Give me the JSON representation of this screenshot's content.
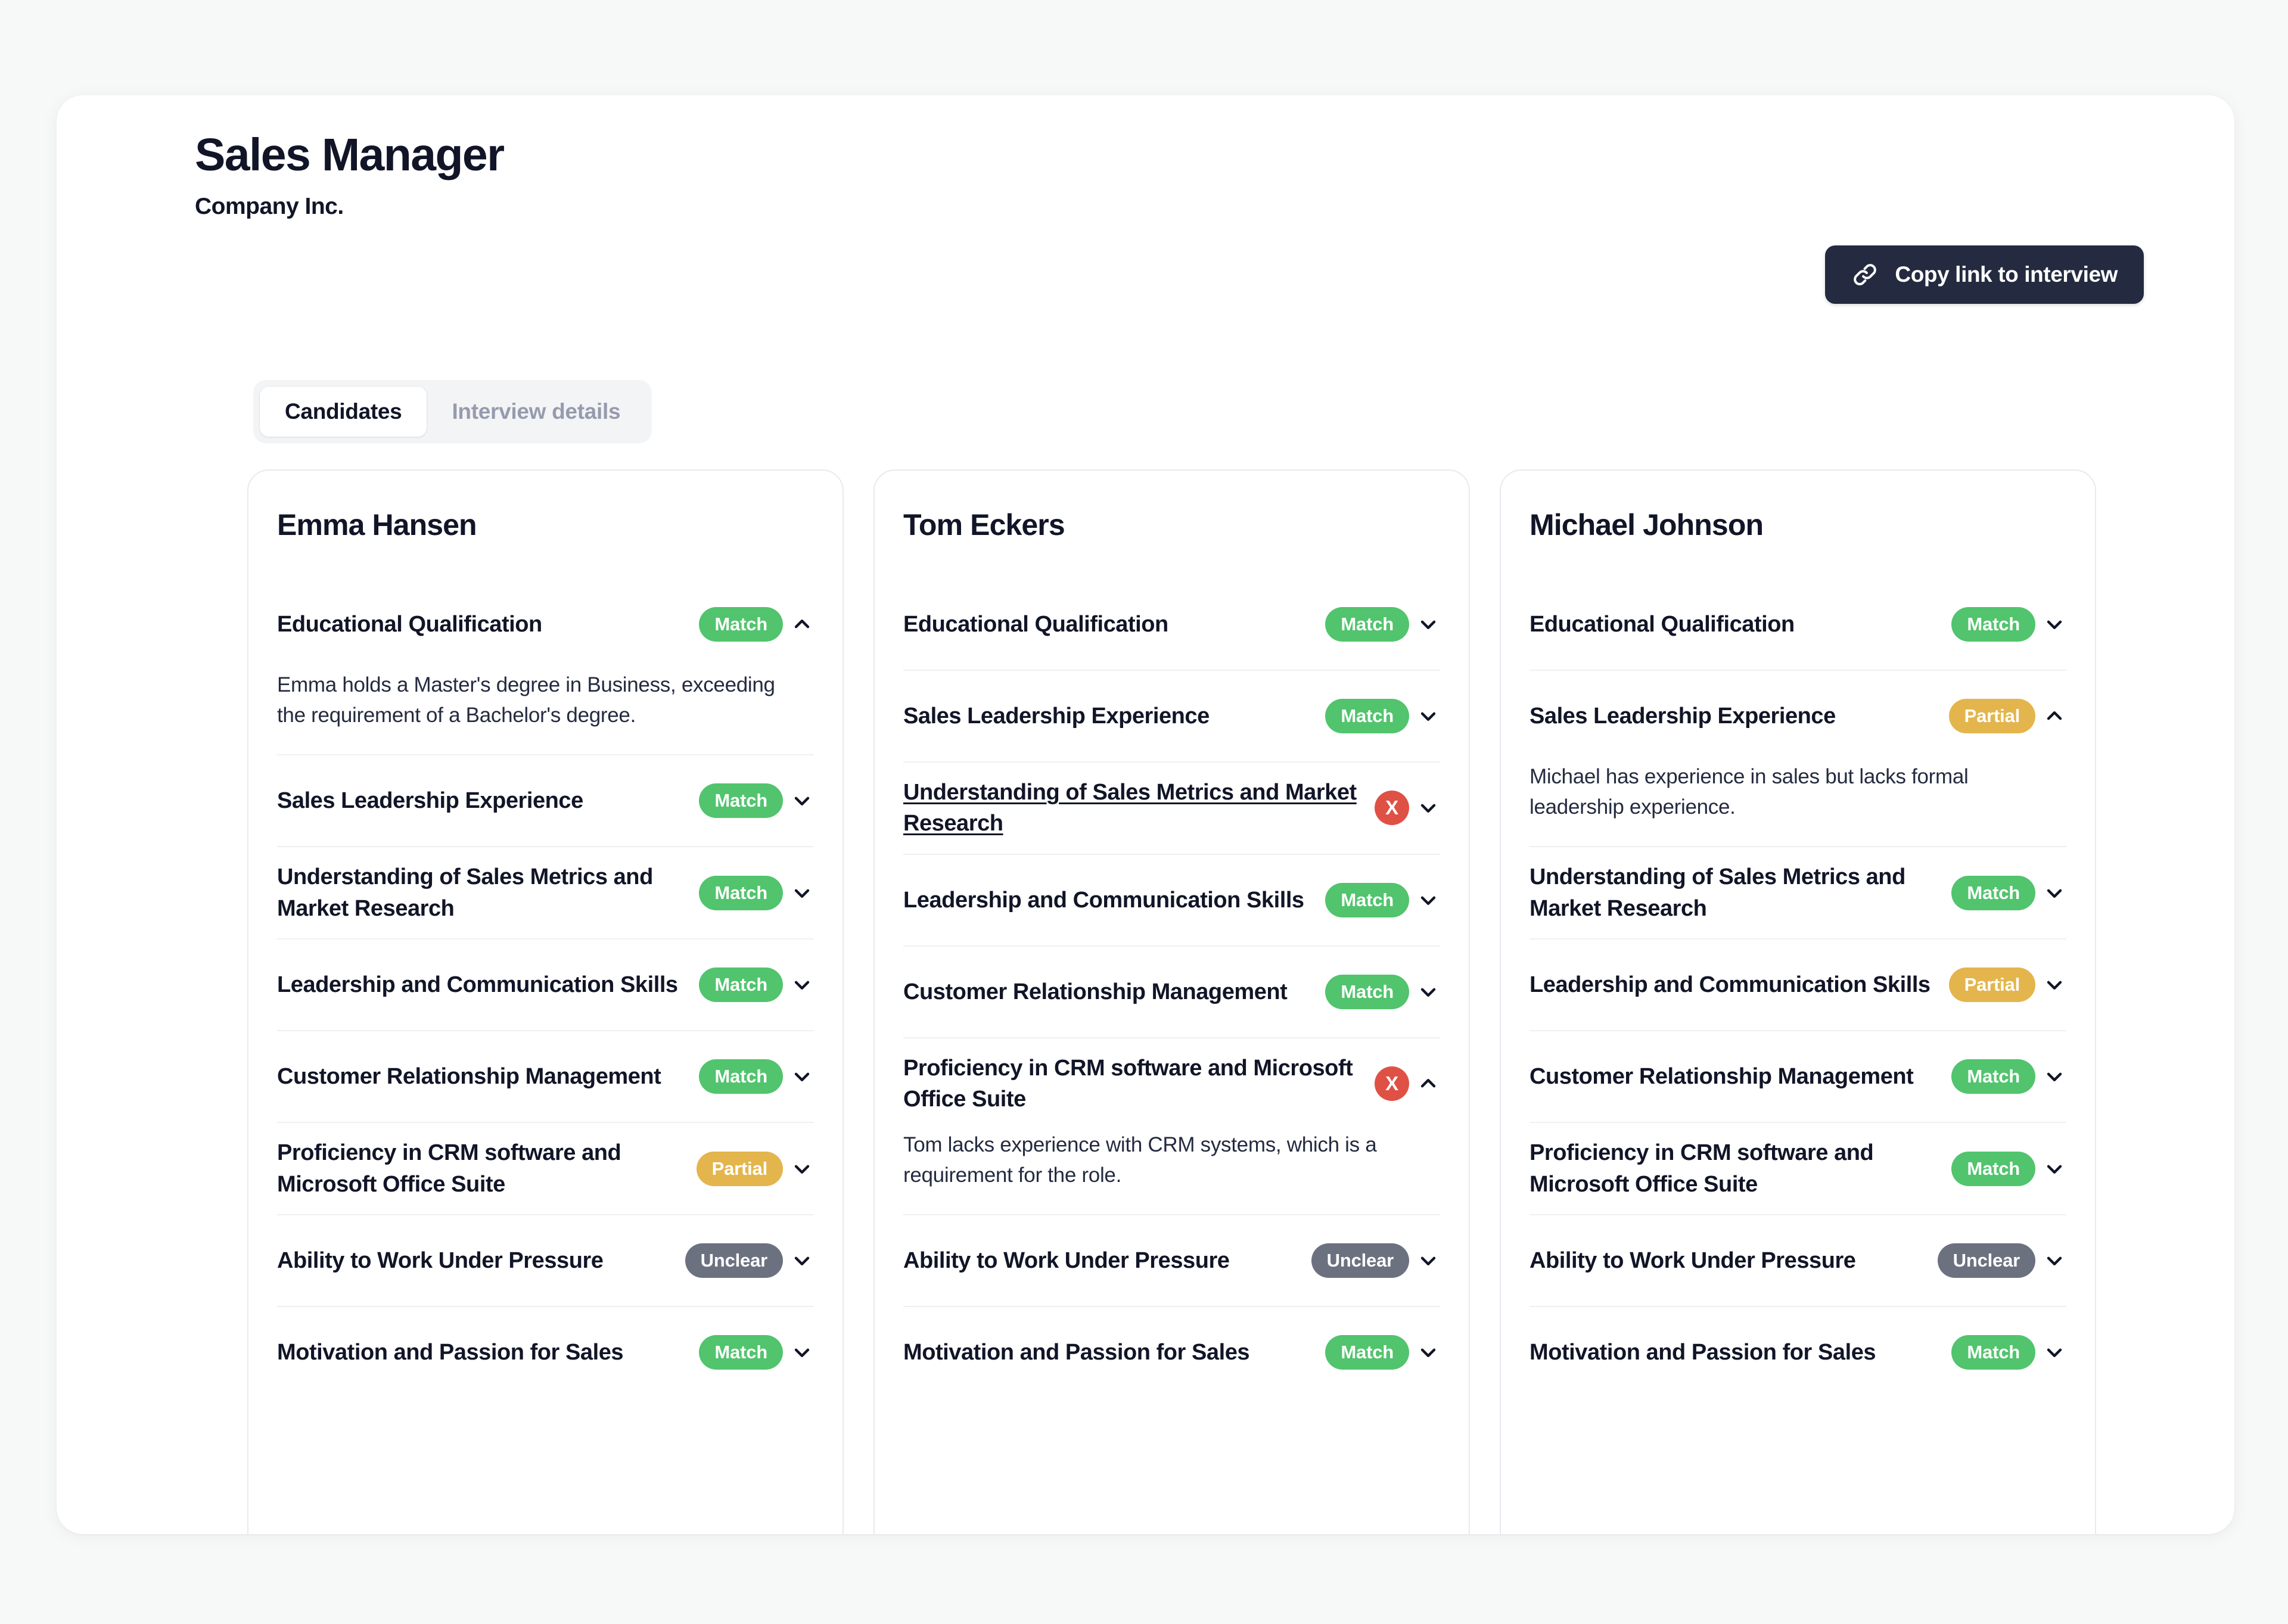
{
  "header": {
    "job_title": "Sales Manager",
    "company": "Company Inc.",
    "copy_link_label": "Copy link to interview",
    "link_icon": "link-icon"
  },
  "tabs": [
    {
      "label": "Candidates",
      "active": true
    },
    {
      "label": "Interview details",
      "active": false
    }
  ],
  "badge_colors": {
    "match": "#51c46d",
    "partial": "#e3b54c",
    "unclear": "#6c7180",
    "fail": "#df5145",
    "button_dark": "#242b40",
    "text_dark": "#111527"
  },
  "candidates": [
    {
      "name": "Emma Hansen",
      "criteria": [
        {
          "label": "Educational Qualification",
          "status": "Match",
          "status_kind": "match",
          "expanded": true,
          "hovered": false,
          "detail": "Emma holds a Master's degree in Business, exceeding the requirement of a Bachelor's degree."
        },
        {
          "label": "Sales Leadership Experience",
          "status": "Match",
          "status_kind": "match",
          "expanded": false,
          "hovered": false,
          "detail": ""
        },
        {
          "label": "Understanding of Sales Metrics and Market Research",
          "status": "Match",
          "status_kind": "match",
          "expanded": false,
          "hovered": false,
          "detail": ""
        },
        {
          "label": "Leadership and Communication Skills",
          "status": "Match",
          "status_kind": "match",
          "expanded": false,
          "hovered": false,
          "detail": ""
        },
        {
          "label": "Customer Relationship Management",
          "status": "Match",
          "status_kind": "match",
          "expanded": false,
          "hovered": false,
          "detail": ""
        },
        {
          "label": "Proficiency in CRM software and Microsoft Office Suite",
          "status": "Partial",
          "status_kind": "partial",
          "expanded": false,
          "hovered": false,
          "detail": ""
        },
        {
          "label": "Ability to Work Under Pressure",
          "status": "Unclear",
          "status_kind": "unclear",
          "expanded": false,
          "hovered": false,
          "detail": ""
        },
        {
          "label": "Motivation and Passion for Sales",
          "status": "Match",
          "status_kind": "match",
          "expanded": false,
          "hovered": false,
          "detail": ""
        }
      ]
    },
    {
      "name": "Tom Eckers",
      "criteria": [
        {
          "label": "Educational Qualification",
          "status": "Match",
          "status_kind": "match",
          "expanded": false,
          "hovered": false,
          "detail": ""
        },
        {
          "label": "Sales Leadership Experience",
          "status": "Match",
          "status_kind": "match",
          "expanded": false,
          "hovered": false,
          "detail": ""
        },
        {
          "label": "Understanding of Sales Metrics and Market Research",
          "status": "X",
          "status_kind": "fail",
          "expanded": false,
          "hovered": true,
          "detail": ""
        },
        {
          "label": "Leadership and Communication Skills",
          "status": "Match",
          "status_kind": "match",
          "expanded": false,
          "hovered": false,
          "detail": ""
        },
        {
          "label": "Customer Relationship Management",
          "status": "Match",
          "status_kind": "match",
          "expanded": false,
          "hovered": false,
          "detail": ""
        },
        {
          "label": "Proficiency in CRM software and Microsoft Office Suite",
          "status": "X",
          "status_kind": "fail",
          "expanded": true,
          "hovered": false,
          "detail": "Tom lacks experience with CRM systems, which is a requirement for the role."
        },
        {
          "label": "Ability to Work Under Pressure",
          "status": "Unclear",
          "status_kind": "unclear",
          "expanded": false,
          "hovered": false,
          "detail": ""
        },
        {
          "label": "Motivation and Passion for Sales",
          "status": "Match",
          "status_kind": "match",
          "expanded": false,
          "hovered": false,
          "detail": ""
        }
      ]
    },
    {
      "name": "Michael Johnson",
      "criteria": [
        {
          "label": "Educational Qualification",
          "status": "Match",
          "status_kind": "match",
          "expanded": false,
          "hovered": false,
          "detail": ""
        },
        {
          "label": "Sales Leadership Experience",
          "status": "Partial",
          "status_kind": "partial",
          "expanded": true,
          "hovered": false,
          "detail": "Michael has experience in sales but lacks formal leadership experience."
        },
        {
          "label": "Understanding of Sales Metrics and Market Research",
          "status": "Match",
          "status_kind": "match",
          "expanded": false,
          "hovered": false,
          "detail": ""
        },
        {
          "label": "Leadership and Communication Skills",
          "status": "Partial",
          "status_kind": "partial",
          "expanded": false,
          "hovered": false,
          "detail": ""
        },
        {
          "label": "Customer Relationship Management",
          "status": "Match",
          "status_kind": "match",
          "expanded": false,
          "hovered": false,
          "detail": ""
        },
        {
          "label": "Proficiency in CRM software and Microsoft Office Suite",
          "status": "Match",
          "status_kind": "match",
          "expanded": false,
          "hovered": false,
          "detail": ""
        },
        {
          "label": "Ability to Work Under Pressure",
          "status": "Unclear",
          "status_kind": "unclear",
          "expanded": false,
          "hovered": false,
          "detail": ""
        },
        {
          "label": "Motivation and Passion for Sales",
          "status": "Match",
          "status_kind": "match",
          "expanded": false,
          "hovered": false,
          "detail": ""
        }
      ]
    }
  ]
}
